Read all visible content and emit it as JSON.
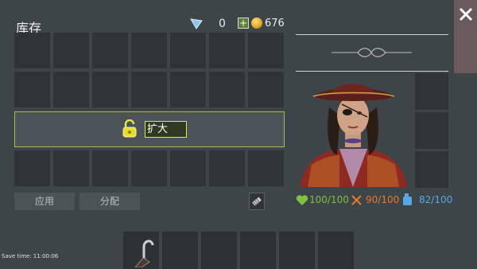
{
  "header": {
    "title": "库存",
    "flag_count": "0",
    "coin_count": "676"
  },
  "inventory": {
    "expand_label": "扩大",
    "apply_label": "应用",
    "distribute_label": "分配"
  },
  "stats": {
    "health": "100/100",
    "food": "90/100",
    "water": "82/100"
  },
  "footer": {
    "save_time": "Save time: 11:00:06"
  },
  "colors": {
    "health": "#7dc242",
    "food": "#e87a2d",
    "water": "#59a8e6",
    "accent": "#a8be49"
  }
}
